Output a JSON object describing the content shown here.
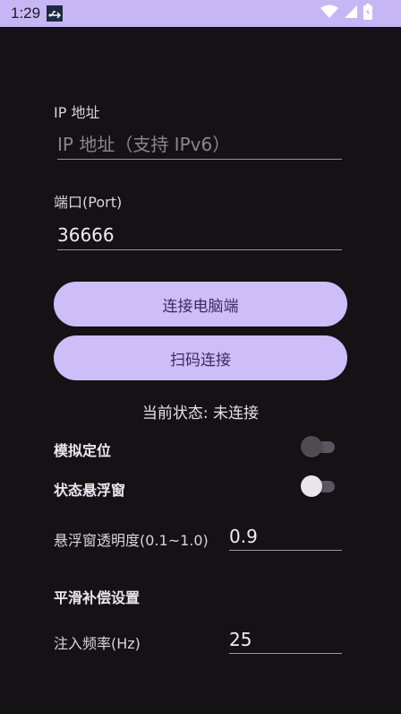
{
  "status_bar": {
    "time": "1:29",
    "icons": [
      "usb-icon",
      "wifi-icon",
      "signal-icon",
      "battery-icon"
    ]
  },
  "ip_field": {
    "label": "IP 地址",
    "value": "",
    "placeholder": "IP 地址（支持 IPv6）"
  },
  "port_field": {
    "label": "端口(Port)",
    "value": "36666"
  },
  "buttons": {
    "connect_pc": "连接电脑端",
    "scan_connect": "扫码连接"
  },
  "connection_status": "当前状态: 未连接",
  "toggles": {
    "mock_location": {
      "label": "模拟定位",
      "enabled": false
    },
    "floating_window": {
      "label": "状态悬浮窗",
      "enabled": false
    }
  },
  "opacity_field": {
    "label": "悬浮窗透明度(0.1~1.0)",
    "value": "0.9"
  },
  "smoothing": {
    "header": "平滑补偿设置",
    "frequency_label": "注入频率(Hz)",
    "frequency_value": "25"
  },
  "colors": {
    "background": "#141214",
    "status_bar": "#c7b6f6",
    "button_bg": "#cdbdf9",
    "button_text": "#3a2a66"
  }
}
